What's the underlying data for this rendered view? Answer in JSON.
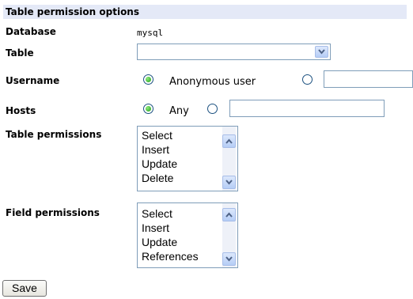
{
  "header": {
    "title": "Table permission options"
  },
  "fields": {
    "database_label": "Database",
    "database_value": "mysql",
    "table_label": "Table",
    "table_value": "",
    "username_label": "Username",
    "username_anonymous": "Anonymous user",
    "username_value": "",
    "hosts_label": "Hosts",
    "hosts_any": "Any",
    "hosts_value": ""
  },
  "table_permissions": {
    "label": "Table permissions",
    "options": [
      "Select",
      "Insert",
      "Update",
      "Delete"
    ]
  },
  "field_permissions": {
    "label": "Field permissions",
    "options": [
      "Select",
      "Insert",
      "Update",
      "References"
    ]
  },
  "actions": {
    "save_label": "Save"
  }
}
